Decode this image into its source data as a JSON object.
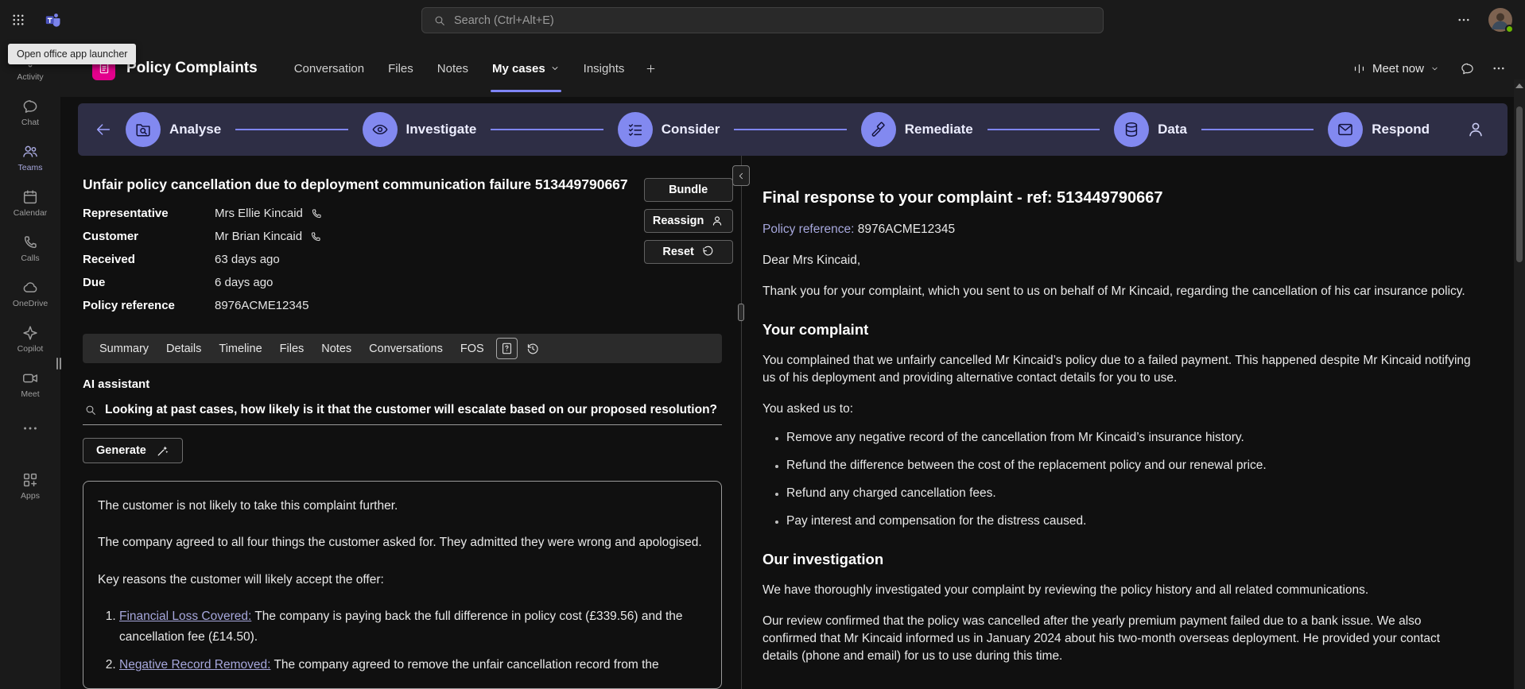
{
  "colors": {
    "accent": "#7f85f5",
    "link": "#a6a7dc",
    "app_icon": "#e3008c",
    "presence_available": "#6bb700"
  },
  "icons": {
    "app_launcher": "grid-dots",
    "search": "magnifier",
    "more": "ellipsis",
    "phone": "phone-receiver",
    "reassign": "person",
    "reset": "undo-arrow",
    "generate": "sparkle-wand",
    "back": "arrow-left",
    "stage_analyse": "folder-search",
    "stage_investigate": "eye",
    "stage_consider": "checklist",
    "stage_remediate": "gavel",
    "stage_data": "database",
    "stage_respond": "envelope",
    "meet_now": "equalizer",
    "collapse": "chevron-left",
    "case_help": "document-question",
    "case_history": "history-clock"
  },
  "topbar": {
    "tooltip": "Open office app launcher",
    "search_placeholder": "Search (Ctrl+Alt+E)"
  },
  "sidebar": {
    "items": [
      {
        "label": "Activity"
      },
      {
        "label": "Chat"
      },
      {
        "label": "Teams"
      },
      {
        "label": "Calendar"
      },
      {
        "label": "Calls"
      },
      {
        "label": "OneDrive"
      },
      {
        "label": "Copilot"
      },
      {
        "label": "Meet"
      },
      {
        "label": ""
      },
      {
        "label": "Apps"
      }
    ]
  },
  "header": {
    "title": "Policy Complaints",
    "tabs": [
      {
        "label": "Conversation"
      },
      {
        "label": "Files"
      },
      {
        "label": "Notes"
      },
      {
        "label": "My cases"
      },
      {
        "label": "Insights"
      }
    ],
    "meet_now_label": "Meet now"
  },
  "stages": [
    {
      "label": "Analyse"
    },
    {
      "label": "Investigate"
    },
    {
      "label": "Consider"
    },
    {
      "label": "Remediate"
    },
    {
      "label": "Data"
    },
    {
      "label": "Respond"
    }
  ],
  "case": {
    "title": "Unfair policy cancellation due to deployment communication failure 513449790667",
    "fields": [
      {
        "label": "Representative",
        "value": "Mrs Ellie Kincaid"
      },
      {
        "label": "Customer",
        "value": "Mr Brian Kincaid"
      },
      {
        "label": "Received",
        "value": "63 days ago"
      },
      {
        "label": "Due",
        "value": "6 days ago"
      },
      {
        "label": "Policy reference",
        "value": "8976ACME12345"
      }
    ],
    "actions": {
      "bundle": "Bundle",
      "reassign": "Reassign",
      "reset": "Reset"
    },
    "tabs": [
      {
        "label": "Summary"
      },
      {
        "label": "Details"
      },
      {
        "label": "Timeline"
      },
      {
        "label": "Files"
      },
      {
        "label": "Notes"
      },
      {
        "label": "Conversations"
      },
      {
        "label": "FOS"
      }
    ]
  },
  "ai": {
    "label": "AI assistant",
    "query": "Looking at past cases, how likely is it that the customer will escalate based on our proposed resolution?",
    "generate_label": "Generate",
    "result": {
      "paragraphs": [
        "The customer is not likely to take this complaint further.",
        "The company agreed to all four things the customer asked for. They admitted they were wrong and apologised.",
        "Key reasons the customer will likely accept the offer:"
      ],
      "items": [
        {
          "title": "Financial Loss Covered:",
          "text": "The company is paying back the full difference in policy cost (£339.56) and the cancellation fee (£14.50)."
        },
        {
          "title": "Negative Record Removed:",
          "text": "The company agreed to remove the unfair cancellation record from the"
        }
      ]
    }
  },
  "letter": {
    "heading": "Final response to your complaint - ref: 513449790667",
    "policy_ref_label": "Policy reference:",
    "policy_ref_value": "8976ACME12345",
    "salutation": "Dear Mrs Kincaid,",
    "intro": "Thank you for your complaint, which you sent to us on behalf of Mr Kincaid, regarding the cancellation of his car insurance policy.",
    "complaint_heading": "Your complaint",
    "complaint_body": "You complained that we unfairly cancelled Mr Kincaid’s policy due to a failed payment. This happened despite Mr Kincaid notifying us of his deployment and providing alternative contact details for you to use.",
    "asked_intro": "You asked us to:",
    "requests": [
      "Remove any negative record of the cancellation from Mr Kincaid’s insurance history.",
      "Refund the difference between the cost of the replacement policy and our renewal price.",
      "Refund any charged cancellation fees.",
      "Pay interest and compensation for the distress caused."
    ],
    "investigation_heading": "Our investigation",
    "investigation_body_1": "We have thoroughly investigated your complaint by reviewing the policy history and all related communications.",
    "investigation_body_2": "Our review confirmed that the policy was cancelled after the yearly premium payment failed due to a bank issue. We also confirmed that Mr Kincaid informed us in January 2024 about his two-month overseas deployment. He provided your contact details (phone and email) for us to use during this time."
  }
}
